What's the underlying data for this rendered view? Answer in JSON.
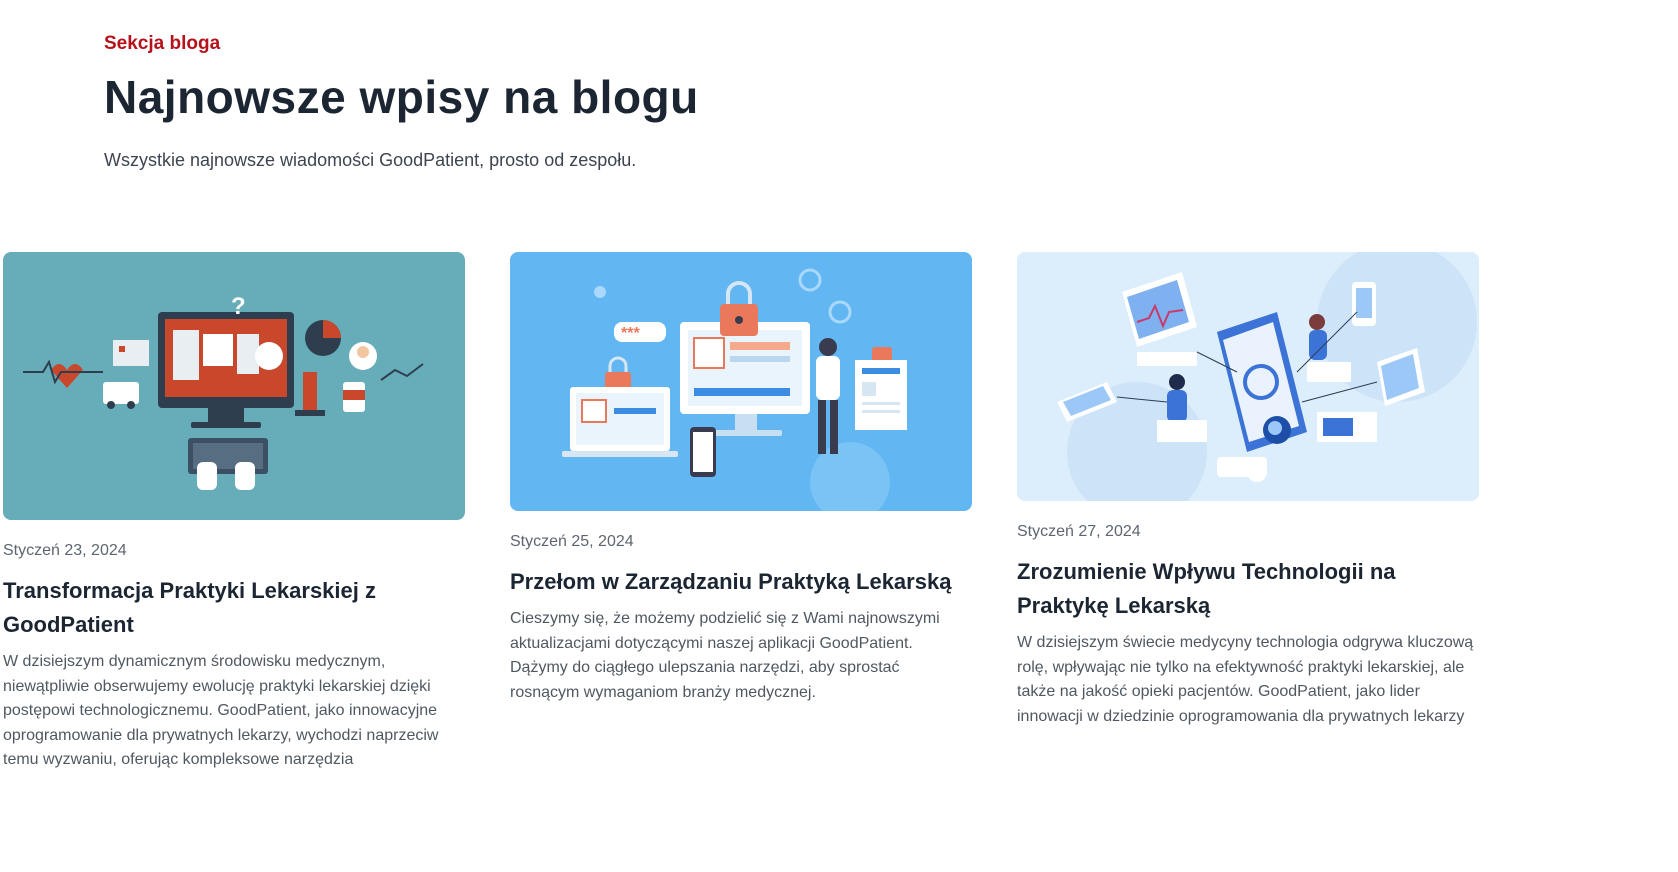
{
  "blog": {
    "eyebrow": "Sekcja bloga",
    "heading": "Najnowsze wpisy na blogu",
    "subheading": "Wszystkie najnowsze wiadomości GoodPatient, prosto od zespołu."
  },
  "posts": [
    {
      "date": "Styczeń 23, 2024",
      "title": "Transformacja Praktyki Lekarskiej z GoodPatient",
      "excerpt": "W dzisiejszym dynamicznym środowisku medycznym, niewątpliwie obserwujemy ewolucję praktyki lekarskiej dzięki postępowi technologicznemu. GoodPatient, jako innowacyjne oprogramowanie dla prywatnych lekarzy, wychodzi naprzeciw temu wyzwaniu, oferując kompleksowe narzędzia",
      "image_icon": "medical-computer-illustration",
      "image_bg": "#66adb9"
    },
    {
      "date": "Styczeń 25, 2024",
      "title": "Przełom w Zarządzaniu Praktyką Lekarską",
      "excerpt": "Cieszymy się, że możemy podzielić się z Wami najnowszymi aktualizacjami dotyczącymi naszej aplikacji GoodPatient. Dążymy do ciągłego ulepszania narzędzi, aby sprostać rosnącym wymaganiom branży medycznej.",
      "image_icon": "medical-security-illustration",
      "image_bg": "#62b6f2"
    },
    {
      "date": "Styczeń 27, 2024",
      "title": "Zrozumienie Wpływu Technologii na Praktykę Lekarską",
      "excerpt": "W dzisiejszym świecie medycyny technologia odgrywa kluczową rolę, wpływając nie tylko na efektywność praktyki lekarskiej, ale także na jakość opieki pacjentów. GoodPatient, jako lider innowacji w dziedzinie oprogramowania dla prywatnych lekarzy",
      "image_icon": "medical-technology-isometric-illustration",
      "image_bg": "#dcedfb"
    }
  ],
  "colors": {
    "accent": "#b5121b",
    "heading": "#1c2633",
    "body_text": "#4f5861"
  }
}
